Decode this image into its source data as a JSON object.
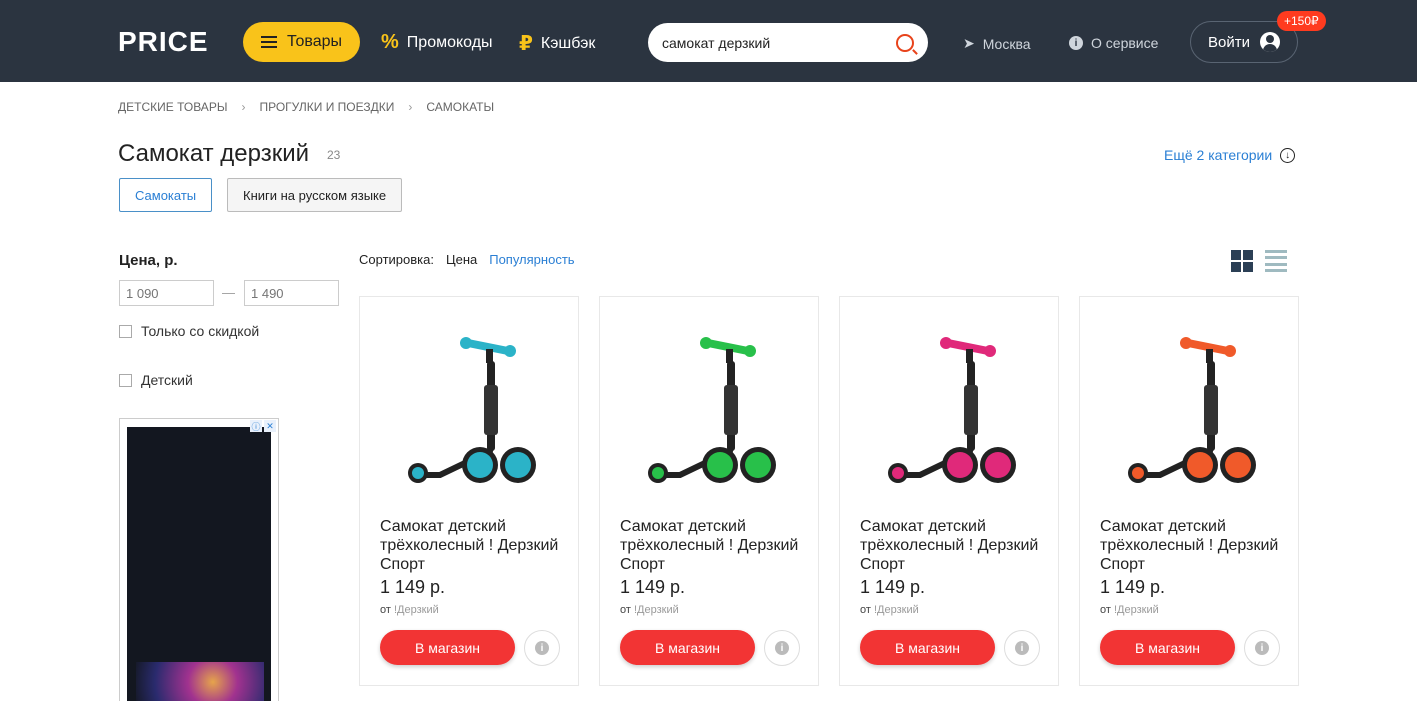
{
  "header": {
    "logo": "PRICE",
    "goods_label": "Товары",
    "promo_label": "Промокоды",
    "cashback_label": "Кэшбэк",
    "search_value": "самокат дерзкий",
    "city": "Москва",
    "about": "О сервисе",
    "login": "Войти",
    "bonus": "+150₽"
  },
  "breadcrumbs": [
    "ДЕТСКИЕ ТОВАРЫ",
    "ПРОГУЛКИ И ПОЕЗДКИ",
    "САМОКАТЫ"
  ],
  "title": "Самокат дерзкий",
  "count": "23",
  "more_categories": "Ещё 2 категории",
  "chips": [
    "Самокаты",
    "Книги на русском языке"
  ],
  "filters": {
    "price_title": "Цена, р.",
    "price_from": "1 090",
    "price_to": "1 490",
    "dash": "—",
    "discount_only": "Только со скидкой",
    "kids": "Детский"
  },
  "sort": {
    "label": "Сортировка:",
    "price": "Цена",
    "popularity": "Популярность"
  },
  "products": [
    {
      "title": "Самокат детский трёхколесный ! Дерзкий Спорт",
      "price": "1 149 р.",
      "from": "от",
      "shop": "!Дерзкий",
      "button": "В магазин",
      "color": "#2bb3c8"
    },
    {
      "title": "Самокат детский трёхколесный ! Дерзкий Спорт",
      "price": "1 149 р.",
      "from": "от",
      "shop": "!Дерзкий",
      "button": "В магазин",
      "color": "#28c04a"
    },
    {
      "title": "Самокат детский трёхколесный ! Дерзкий Спорт",
      "price": "1 149 р.",
      "from": "от",
      "shop": "!Дерзкий",
      "button": "В магазин",
      "color": "#e0297a"
    },
    {
      "title": "Самокат детский трёхколесный ! Дерзкий Спорт",
      "price": "1 149 р.",
      "from": "от",
      "shop": "!Дерзкий",
      "button": "В магазин",
      "color": "#f05a2a"
    }
  ]
}
